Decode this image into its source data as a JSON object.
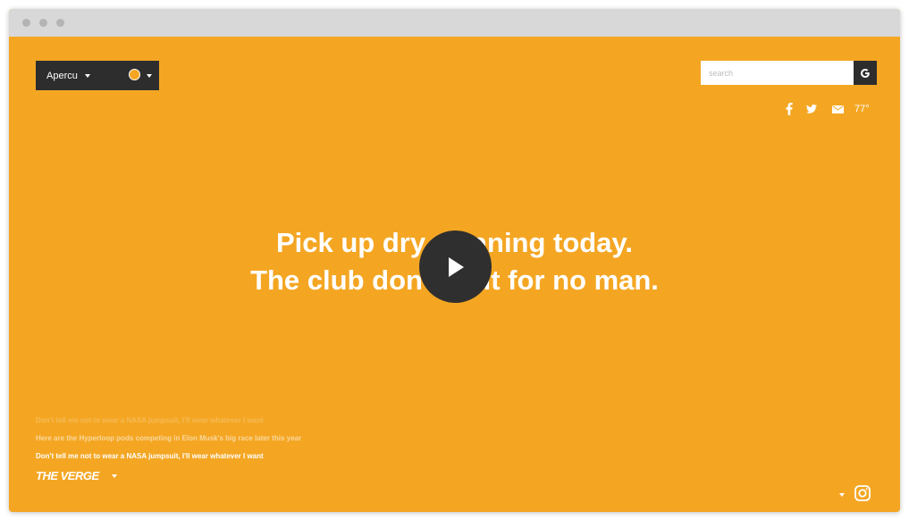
{
  "window": {
    "font_picker": {
      "font_name": "Apercu",
      "swatch_color": "#F4A623"
    },
    "search": {
      "placeholder": "search",
      "button_icon": "google-g-icon"
    },
    "social_icons": [
      "facebook-icon",
      "twitter-icon",
      "mail-icon"
    ],
    "temperature": "77°",
    "headline": {
      "line1": "Pick up dry cleaning today.",
      "line2": "The club don't wait for no man."
    },
    "stories": [
      "Don't tell me not to wear a NASA jumpsuit, I'll wear whatever I want",
      "Here are the Hyperloop pods competing in Elon Musk's big race later this year",
      "Don't tell me not to wear a NASA jumpsuit, I'll wear whatever I want"
    ],
    "brand": "THE VERGE",
    "colors": {
      "background": "#F4A623",
      "dark": "#2d2d2d",
      "text": "#ffffff"
    }
  }
}
